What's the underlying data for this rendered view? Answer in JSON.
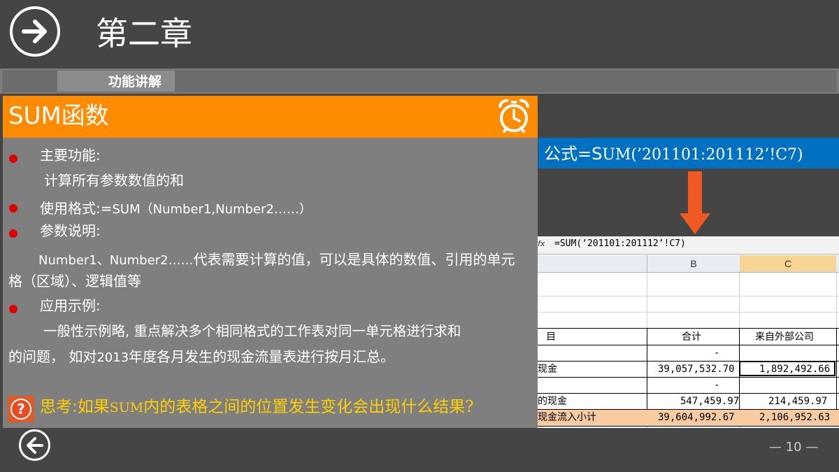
{
  "header": {
    "title": "第二章"
  },
  "section": {
    "label": "功能讲解"
  },
  "panel": {
    "title": "SUM函数",
    "items": [
      {
        "label": "主要功能:"
      },
      {
        "detail": "计算所有参数数值的和"
      },
      {
        "label_prefix": "使用格式:=",
        "label_code": "SUM（Number1,Number2……）"
      },
      {
        "label": "参数说明:"
      },
      {
        "code": "Number1、Number2……",
        "text": "代表需要计算的值，可以是具体的数值、引用的单元",
        "text2": "格（区域）、逻辑值等"
      },
      {
        "label": "应用示例:"
      },
      {
        "text1": "一般性示例略, 重点解决多个相同格式的工作表对同一单元格进行求和",
        "text2a": "的问题，  如对",
        "year": "2013",
        "text2b": "年度各月发生的现金流量表进行按月汇总。"
      }
    ],
    "think": {
      "icon": "question-icon",
      "prefix": "思考:如果",
      "code": "SUM",
      "suffix": "内的表格之间的位置发生变化会出现什么结果",
      "qmark": "?"
    }
  },
  "formula": {
    "label": "公式=",
    "s": "S",
    "expr": "UM(’201101:201112’!C7)"
  },
  "sheet": {
    "formula_bar": "=SUM(’201101:201112’!C7)",
    "fx_icon": "fx-icon",
    "columns": [
      "B",
      "C"
    ],
    "rows": [
      {
        "a": "",
        "b": "",
        "c": ""
      },
      {
        "a": "目",
        "b": "合计",
        "c": "来自外部公司"
      },
      {
        "a": "",
        "b": "-",
        "c": ""
      },
      {
        "a": "现金",
        "b": "39,057,532.70",
        "c": "1,892,492.66"
      },
      {
        "a": "",
        "b": "-",
        "c": ""
      },
      {
        "a": "的现金",
        "b": "547,459.97",
        "c": "214,459.97"
      },
      {
        "a": "现金流入小计",
        "b": "39,604,992.67",
        "c": "2,106,952.63"
      }
    ]
  },
  "footer": {
    "page": "— 10 —"
  },
  "colors": {
    "orange": "#ff8b00",
    "blue": "#0070c0",
    "arrow": "#f05a22",
    "bullet": "#e00000",
    "highlight_row": "#f8cba0"
  }
}
